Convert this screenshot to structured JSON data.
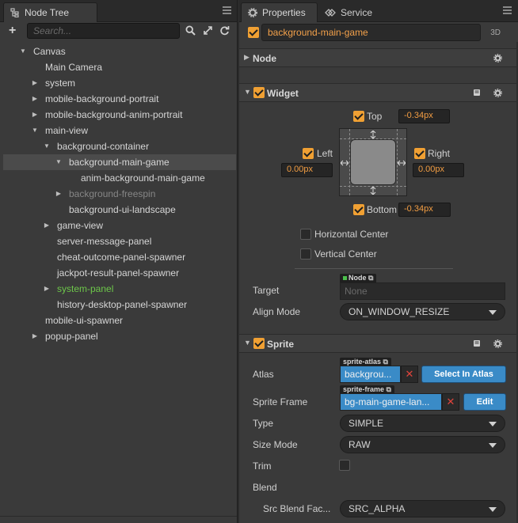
{
  "node_tree": {
    "tab_label": "Node Tree",
    "search_placeholder": "Search...",
    "items": [
      {
        "label": "Canvas",
        "arrow": "▼"
      },
      {
        "label": "Main Camera",
        "arrow": ""
      },
      {
        "label": "system",
        "arrow": "▶"
      },
      {
        "label": "mobile-background-portrait",
        "arrow": "▶"
      },
      {
        "label": "mobile-background-anim-portrait",
        "arrow": "▶"
      },
      {
        "label": "main-view",
        "arrow": "▼"
      },
      {
        "label": "background-container",
        "arrow": "▼"
      },
      {
        "label": "background-main-game",
        "arrow": "▼",
        "selected": true
      },
      {
        "label": "anim-background-main-game",
        "arrow": ""
      },
      {
        "label": "background-freespin",
        "arrow": "▶",
        "dim": true
      },
      {
        "label": "background-ui-landscape",
        "arrow": ""
      },
      {
        "label": "game-view",
        "arrow": "▶"
      },
      {
        "label": "server-message-panel",
        "arrow": ""
      },
      {
        "label": "cheat-outcome-panel-spawner",
        "arrow": ""
      },
      {
        "label": "jackpot-result-panel-spawner",
        "arrow": ""
      },
      {
        "label": "system-panel",
        "arrow": "▶",
        "active": true
      },
      {
        "label": "history-desktop-panel-spawner",
        "arrow": ""
      },
      {
        "label": "mobile-ui-spawner",
        "arrow": ""
      },
      {
        "label": "popup-panel",
        "arrow": "▶"
      }
    ]
  },
  "properties": {
    "tab_label": "Properties",
    "service_tab_label": "Service",
    "node_name": "background-main-game",
    "tag_3d": "3D",
    "node_section": "Node",
    "widget": {
      "title": "Widget",
      "top_label": "Top",
      "top_value": "-0.34px",
      "left_label": "Left",
      "left_value": "0.00px",
      "right_label": "Right",
      "right_value": "0.00px",
      "bottom_label": "Bottom",
      "bottom_value": "-0.34px",
      "horizontal_center": "Horizontal Center",
      "vertical_center": "Vertical Center",
      "target_label": "Target",
      "target_tag": "Node",
      "target_value": "None",
      "align_mode_label": "Align Mode",
      "align_mode_value": "ON_WINDOW_RESIZE"
    },
    "sprite": {
      "title": "Sprite",
      "atlas_label": "Atlas",
      "atlas_tag": "sprite-atlas",
      "atlas_value": "backgrou...",
      "select_in_atlas": "Select In Atlas",
      "sprite_frame_label": "Sprite Frame",
      "sprite_frame_tag": "sprite-frame",
      "sprite_frame_value": "bg-main-game-lan...",
      "edit": "Edit",
      "type_label": "Type",
      "type_value": "SIMPLE",
      "size_mode_label": "Size Mode",
      "size_mode_value": "RAW",
      "trim_label": "Trim",
      "blend_label": "Blend",
      "src_blend_label": "Src Blend Fac...",
      "src_blend_value": "SRC_ALPHA"
    }
  },
  "colors": {
    "accent_orange": "#f0a033",
    "value_orange": "#f29d43",
    "active_green": "#6dc74a",
    "button_blue": "#3a8bc7"
  }
}
